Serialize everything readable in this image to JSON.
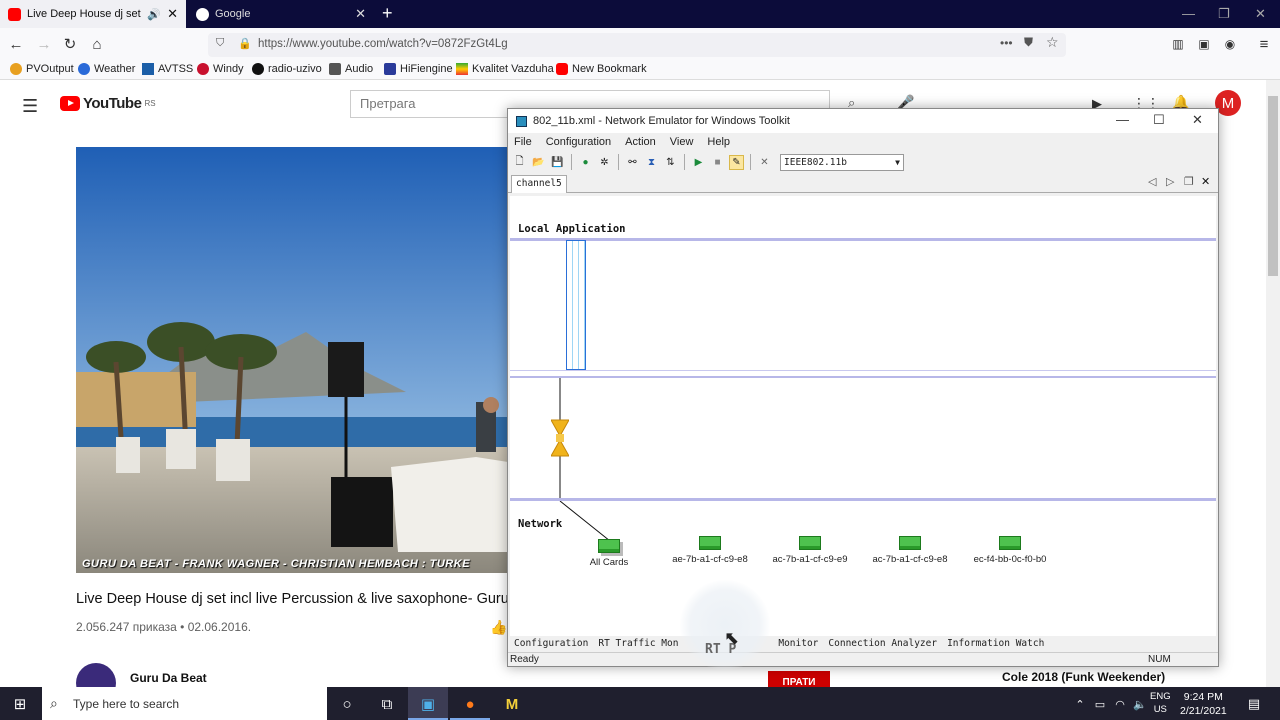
{
  "browser": {
    "tabs": [
      {
        "title": "Live Deep House dj set incl",
        "active": true
      },
      {
        "title": "Google",
        "active": false
      }
    ],
    "new_tab": "+",
    "url": "https://www.youtube.com/watch?v=0872FzGt4Lg",
    "bookmarks": [
      "PVOutput",
      "Weather",
      "AVTSS",
      "Windy",
      "radio-uzivo",
      "Audio",
      "HiFiengine",
      "Kvalitet Vazduha",
      "New Bookmark"
    ]
  },
  "youtube": {
    "logo": "YouTube",
    "region": "RS",
    "search_placeholder": "Претрага",
    "avatar_letter": "M",
    "video_caption": "GURU DA BEAT - FRANK WAGNER - CHRISTIAN HEMBACH : TURKE",
    "video_title": "Live Deep House dj set incl live Percussion & live saxophone- Guru",
    "video_meta": "2.056.247 приказа • 02.06.2016.",
    "channel_name": "Guru Da Beat",
    "subscribe_label": "ПРАТИ",
    "side_video_title": "Cole 2018 (Funk Weekender)"
  },
  "emulator": {
    "title": "802_11b.xml - Network Emulator for Windows Toolkit",
    "menu": [
      "File",
      "Configuration",
      "Action",
      "View",
      "Help"
    ],
    "standard": "IEEE802.11b",
    "tab": "channel5",
    "lanes": {
      "local": "Local Application",
      "network": "Network"
    },
    "nodes": [
      "All Cards",
      "ae-7b-a1-cf-c9-e8",
      "ac-7b-a1-cf-c9-e9",
      "ac-7b-a1-cf-c9-e8",
      "ec-f4-bb-0c-f0-b0"
    ],
    "bottom_tabs": [
      "Configuration",
      "RT Traffic Mon",
      "Monitor",
      "Connection Analyzer",
      "Information Watch"
    ],
    "cursor_overlay": "RT P",
    "status": "Ready",
    "num": "NUM"
  },
  "taskbar": {
    "search_placeholder": "Type here to search",
    "lang": "ENG",
    "region": "US",
    "time": "9:24 PM",
    "date": "2/21/2021"
  }
}
